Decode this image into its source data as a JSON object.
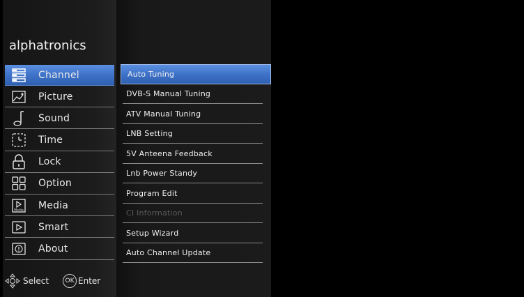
{
  "brand": "alphatronics",
  "menu": {
    "items": [
      {
        "label": "Channel",
        "icon": "channel-list-icon",
        "active": true
      },
      {
        "label": "Picture",
        "icon": "picture-icon"
      },
      {
        "label": "Sound",
        "icon": "music-note-icon"
      },
      {
        "label": "Time",
        "icon": "time-icon"
      },
      {
        "label": "Lock",
        "icon": "lock-icon"
      },
      {
        "label": "Option",
        "icon": "grid-icon"
      },
      {
        "label": "Media",
        "icon": "media-icon",
        "icon_text": "Media"
      },
      {
        "label": "Smart",
        "icon": "play-icon"
      },
      {
        "label": "About",
        "icon": "info-icon"
      }
    ]
  },
  "submenu": {
    "items": [
      {
        "label": "Auto Tuning",
        "active": true
      },
      {
        "label": "DVB-S Manual Tuning"
      },
      {
        "label": "ATV Manual Tuning"
      },
      {
        "label": "LNB Setting"
      },
      {
        "label": "5V Anteena Feedback"
      },
      {
        "label": "Lnb Power Standy"
      },
      {
        "label": "Program Edit"
      },
      {
        "label": "CI Information",
        "disabled": true
      },
      {
        "label": "Setup Wizard"
      },
      {
        "label": "Auto Channel Update"
      }
    ]
  },
  "footer": {
    "select_label": "Select",
    "ok_icon_text": "OK",
    "enter_label": "Enter"
  },
  "colors": {
    "highlight": "#3f73c9",
    "background": "#000000"
  }
}
